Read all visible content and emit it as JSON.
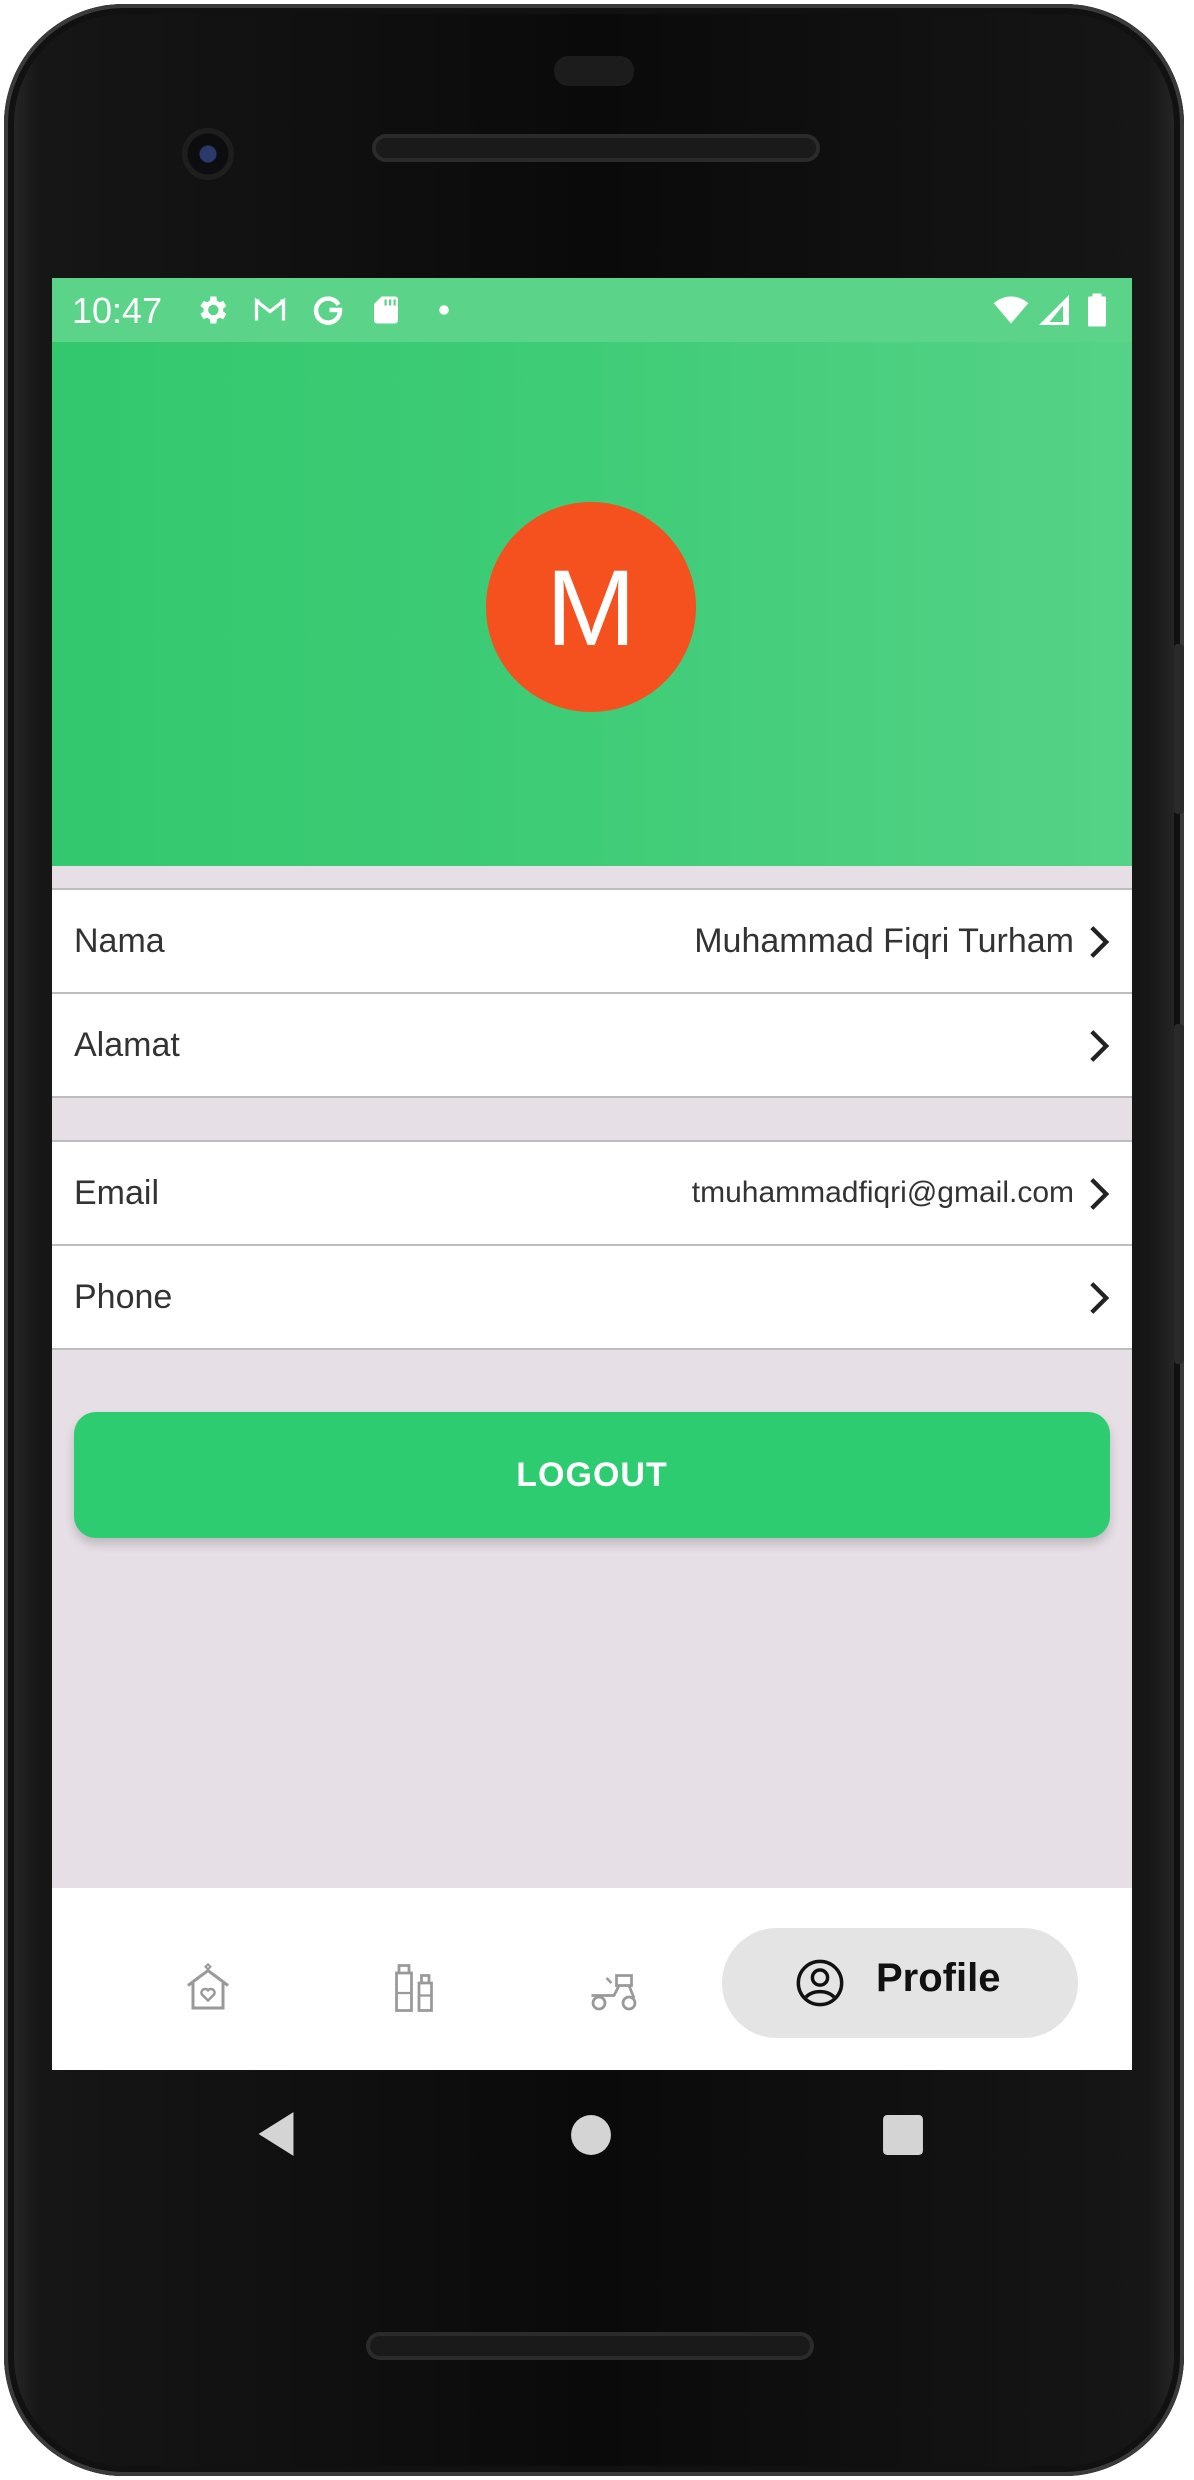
{
  "status_bar": {
    "time": "10:47",
    "icons": [
      "gear-icon",
      "gmail-icon",
      "google-icon",
      "sd-card-icon",
      "dot-icon",
      "wifi-icon",
      "signal-icon",
      "battery-icon"
    ]
  },
  "profile": {
    "avatar_initial": "M",
    "avatar_color": "#f4511e",
    "header_color": "#3fcc77"
  },
  "fields": [
    {
      "label": "Nama",
      "value": "Muhammad Fiqri Turham"
    },
    {
      "label": "Alamat",
      "value": ""
    },
    {
      "label": "Email",
      "value": "tmuhammadfiqri@gmail.com"
    },
    {
      "label": "Phone",
      "value": ""
    }
  ],
  "logout_label": "LOGOUT",
  "accent_color": "#2ecc71",
  "bottom_nav": {
    "items": [
      "home-icon",
      "products-icon",
      "delivery-icon"
    ],
    "active_label": "Profile",
    "active_icon": "profile-icon"
  },
  "system_nav": [
    "back-icon",
    "home-circle-icon",
    "recents-icon"
  ]
}
